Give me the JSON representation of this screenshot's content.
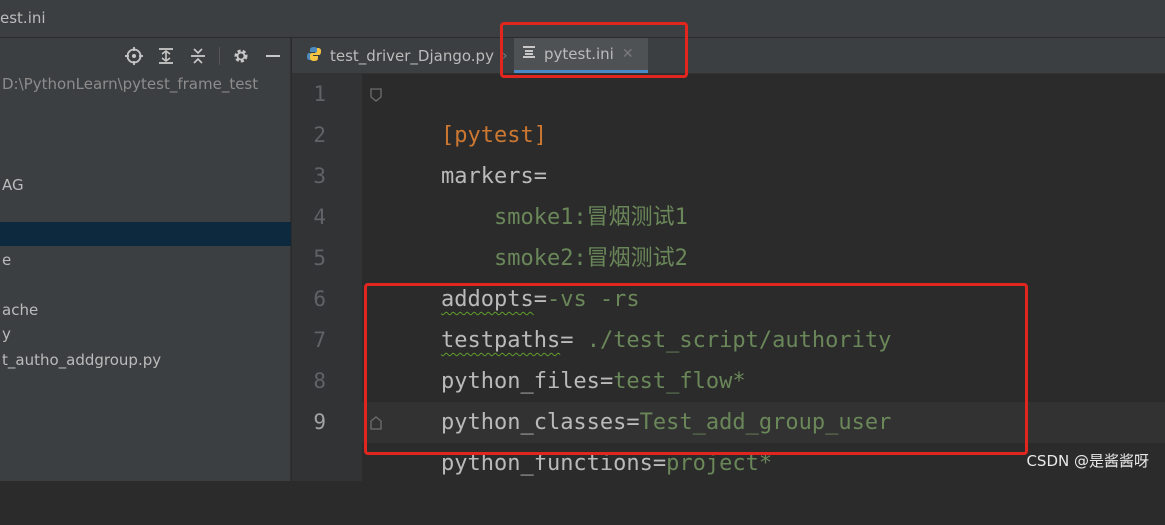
{
  "window": {
    "title": "est.ini"
  },
  "project_panel": {
    "toolbar_icons": [
      "locate-icon",
      "expand-all-icon",
      "collapse-all-icon",
      "gear-icon",
      "minimize-icon"
    ],
    "items": [
      {
        "label": "D:\\PythonLearn\\pytest_frame_test",
        "type": "path"
      },
      {
        "label": "AG",
        "type": "item"
      },
      {
        "label": "",
        "type": "selected"
      },
      {
        "label": "e",
        "type": "item"
      },
      {
        "label": "ache",
        "type": "item"
      },
      {
        "label": "y",
        "type": "item"
      },
      {
        "label": "t_autho_addgroup.py",
        "type": "item"
      }
    ]
  },
  "tabs": [
    {
      "label": "test_driver_Django.py",
      "icon": "python-file-icon",
      "active": false
    },
    {
      "label": "pytest.ini",
      "icon": "ini-file-icon",
      "active": true
    }
  ],
  "editor": {
    "current_line": 9,
    "lines": [
      {
        "num": "1",
        "key": "[pytest]",
        "sep": "",
        "value": ""
      },
      {
        "num": "2",
        "key": "markers",
        "sep": "=",
        "value": ""
      },
      {
        "num": "3",
        "key": "",
        "sep": "",
        "value": "    smoke1:冒烟测试1"
      },
      {
        "num": "4",
        "key": "",
        "sep": "",
        "value": "    smoke2:冒烟测试2"
      },
      {
        "num": "5",
        "key": "addopts",
        "sep": "=",
        "value": "-vs -rs"
      },
      {
        "num": "6",
        "key": "testpaths",
        "sep": "=",
        "value": " ./test_script/authority"
      },
      {
        "num": "7",
        "key": "python_files",
        "sep": "=",
        "value": "test_flow*"
      },
      {
        "num": "8",
        "key": "python_classes",
        "sep": "=",
        "value": "Test_add_group_user"
      },
      {
        "num": "9",
        "key": "python_functions",
        "sep": "=",
        "value": "project*"
      }
    ]
  },
  "watermark": "CSDN @是酱酱呀",
  "colors": {
    "section": "#cc7832",
    "key": "#bababa",
    "value": "#6a8759",
    "annotation_red": "#e0261f",
    "active_tab_underline": "#4a88c7"
  }
}
